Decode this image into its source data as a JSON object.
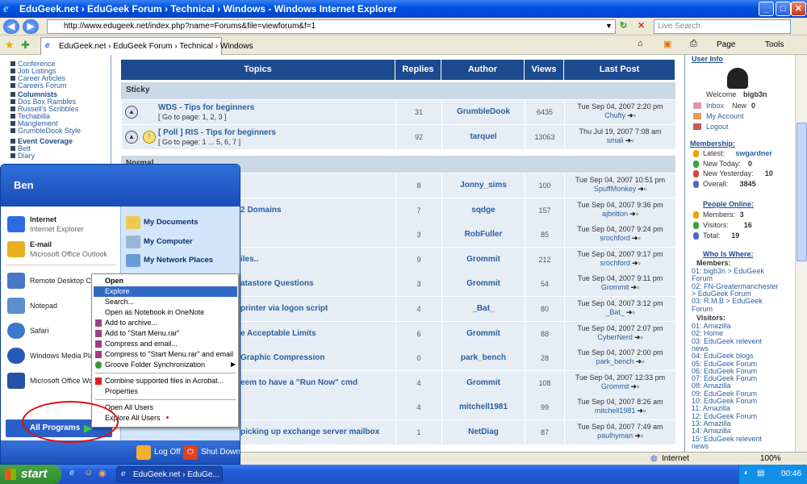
{
  "window": {
    "title": "EduGeek.net › EduGeek Forum › Technical › Windows - Windows Internet Explorer"
  },
  "addressbar": {
    "url": "http://www.edugeek.net/index.php?name=Forums&file=viewforum&f=1",
    "search_placeholder": "Live Search"
  },
  "tab": {
    "title": "EduGeek.net › EduGeek Forum › Technical › Windows"
  },
  "toolbar": {
    "page": "Page",
    "tools": "Tools"
  },
  "leftnav": {
    "items": [
      "Conference",
      "Job Listings",
      "Career Articles",
      "Careers Forum",
      "Columnists",
      "Dos Box Rambles",
      "Russell's Scribbles",
      "Techabilla",
      "Manglement",
      "GrumbleDook Style",
      "Event Coverage",
      "Bett",
      "Diary"
    ]
  },
  "forum": {
    "headers": [
      "Topics",
      "Replies",
      "Author",
      "Views",
      "Last Post"
    ],
    "sticky_label": "Sticky",
    "normal_label": "Normal",
    "sticky": [
      {
        "title": "WDS - Tips for beginners",
        "pages": "[ Go to page: 1, 2, 3 ]",
        "replies": "31",
        "author": "GrumbleDook",
        "views": "6435",
        "last_date": "Tue Sep 04, 2007 2:20 pm",
        "last_user": "Chufty"
      },
      {
        "title": "[ Poll ] RIS - Tips for beginners",
        "pages": "[ Go to page: 1 ... 5, 6, 7 ]",
        "replies": "92",
        "author": "tarquel",
        "views": "13063",
        "last_date": "Thu Jul 19, 2007 7:08 am",
        "last_user": "smali"
      }
    ],
    "normal": [
      {
        "title": "",
        "replies": "8",
        "author": "Jonny_sims",
        "views": "100",
        "last_date": "Tue Sep 04, 2007 10:51 pm",
        "last_user": "SpuffMonkey"
      },
      {
        "title": "2 Domains",
        "replies": "7",
        "author": "sqdge",
        "views": "157",
        "last_date": "Tue Sep 04, 2007 9:36 pm",
        "last_user": "ajbritton"
      },
      {
        "title": "",
        "replies": "3",
        "author": "RobFuller",
        "views": "85",
        "last_date": "Tue Sep 04, 2007 9:24 pm",
        "last_user": "srochford"
      },
      {
        "title": "iles..",
        "replies": "9",
        "author": "Grommit",
        "views": "212",
        "last_date": "Tue Sep 04, 2007 9:17 pm",
        "last_user": "srochford"
      },
      {
        "title": "atastore Questions",
        "replies": "3",
        "author": "Grommit",
        "views": "54",
        "last_date": "Tue Sep 04, 2007 9:11 pm",
        "last_user": "Grommit"
      },
      {
        "title": "printer via logon script",
        "replies": "4",
        "author": "_Bat_",
        "views": "80",
        "last_date": "Tue Sep 04, 2007 3:12 pm",
        "last_user": "_Bat_"
      },
      {
        "title": "e Acceptable Limits",
        "replies": "6",
        "author": "Grommit",
        "views": "88",
        "last_date": "Tue Sep 04, 2007 2:07 pm",
        "last_user": "CyberNerd"
      },
      {
        "title": "Graphic Compression",
        "replies": "0",
        "author": "park_bench",
        "views": "28",
        "last_date": "Tue Sep 04, 2007 2:00 pm",
        "last_user": "park_bench"
      },
      {
        "title": "eem to have a \"Run Now\" cmd",
        "replies": "4",
        "author": "Grommit",
        "views": "108",
        "last_date": "Tue Sep 04, 2007 12:33 pm",
        "last_user": "Grommit"
      },
      {
        "title": "",
        "replies": "4",
        "author": "mitchell1981",
        "views": "99",
        "last_date": "Tue Sep 04, 2007 8:26 am",
        "last_user": "mitchell1981"
      },
      {
        "title": "picking up exchange server mailbox",
        "replies": "1",
        "author": "NetDiag",
        "views": "87",
        "last_date": "Tue Sep 04, 2007 7:49 am",
        "last_user": "paulhyman"
      }
    ]
  },
  "rightnav": {
    "userinfo": "User Info",
    "welcome": "Welcome",
    "username": "bigb3n",
    "inbox": "Inbox",
    "new_label": "New",
    "new_count": "0",
    "myaccount": "My Account",
    "logout": "Logout",
    "membership": "Membership:",
    "latest_label": "Latest:",
    "latest": "swgardner",
    "newtoday_label": "New Today:",
    "newtoday": "0",
    "newyesterday_label": "New Yesterday:",
    "newyesterday": "10",
    "overall_label": "Overall:",
    "overall": "3845",
    "online": "People Online:",
    "members_label": "Members:",
    "members": "3",
    "visitors_label": "Visitors:",
    "visitors": "16",
    "total_label": "Total:",
    "total": "19",
    "whoiswhere": "Who Is Where:",
    "members_hd": "Members:",
    "member_lines": [
      "01: bigb3n > EduGeek",
      "Forum",
      "02: FN-Greatermanchester",
      "> EduGeek Forum",
      "03: R.M.B > EduGeek",
      "Forum"
    ],
    "visitors_hd": "Visitors:",
    "visitor_lines": [
      "01: Amazilla",
      "02: Home",
      "03: EduGeek relevent",
      "news",
      "04: EduGeek blogs",
      "05: EduGeek Forum",
      "06: EduGeek Forum",
      "07: EduGeek Forum",
      "08: Amazilla",
      "09: EduGeek Forum",
      "10: EduGeek Forum",
      "11: Amazilla",
      "12: EduGeek Forum",
      "13: Amazilla",
      "14: Amazilla",
      "15: EduGeek relevent",
      "news"
    ]
  },
  "startmenu": {
    "user": "Ben",
    "pinned": [
      {
        "title": "Internet",
        "sub": "Internet Explorer"
      },
      {
        "title": "E-mail",
        "sub": "Microsoft Office Outlook"
      }
    ],
    "recent": [
      "Remote Desktop Conn",
      "Notepad",
      "Safari",
      "Windows Media Playe",
      "Microsoft Office Wor"
    ],
    "right": [
      "My Documents",
      "My Computer",
      "My Network Places"
    ],
    "all_programs": "All Programs",
    "logoff": "Log Off",
    "shutdown": "Shut Down"
  },
  "context_menu": {
    "items": [
      "Open",
      "Explore",
      "Search...",
      "Open as Notebook in OneNote",
      "Add to archive...",
      "Add to \"Start Menu.rar\"",
      "Compress and email...",
      "Compress to \"Start Menu.rar\" and email",
      "Groove Folder Synchronization",
      "Combine supported files in Acrobat...",
      "Properties",
      "Open All Users",
      "Explore All Users"
    ]
  },
  "statusbar": {
    "zone": "Internet",
    "zoom": "100%"
  },
  "taskbar": {
    "start": "start",
    "task": "EduGeek.net › EduGe...",
    "clock": "00:46"
  },
  "colors": {
    "forum_header": "#1c4a8f",
    "link": "#2a5e9e",
    "row_bg": "#e7edf4",
    "annotation": "#e01010"
  }
}
